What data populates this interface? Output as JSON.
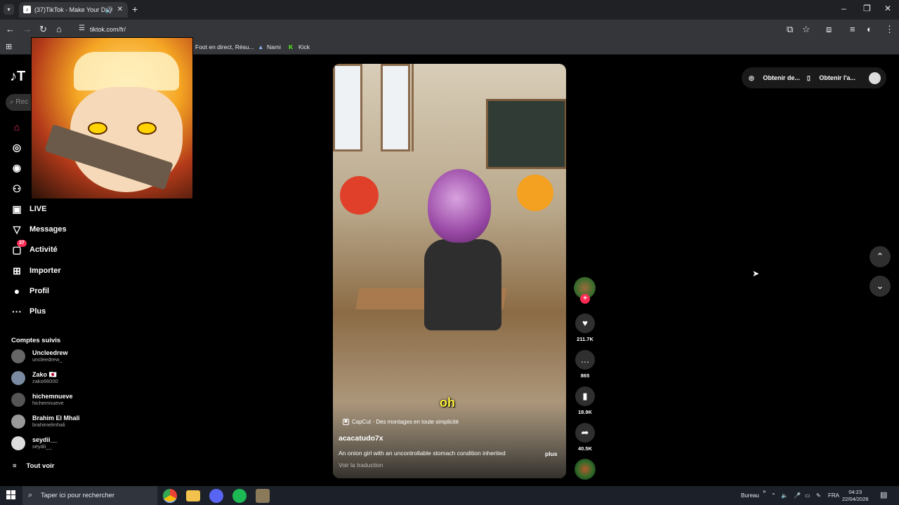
{
  "browser": {
    "tab_title": "(37)TikTok - Make Your Day",
    "tab_favicon": "tiktok-icon",
    "url": "tiktok.com/fr/",
    "bookmarks": [
      {
        "label": "Foot en direct, Résu..."
      },
      {
        "label": "Nami"
      },
      {
        "label": "Kick"
      }
    ]
  },
  "sidebar": {
    "logo": "T",
    "search_placeholder": "Rec",
    "nav": [
      {
        "label": "",
        "icon": "home-icon"
      },
      {
        "label": "",
        "icon": "compass-icon"
      },
      {
        "label": "",
        "icon": "following-icon"
      },
      {
        "label": "",
        "icon": "friends-icon"
      },
      {
        "label": "LIVE",
        "icon": "live-icon"
      },
      {
        "label": "Messages",
        "icon": "messages-icon"
      },
      {
        "label": "Activité",
        "icon": "activity-icon",
        "badge": "37"
      },
      {
        "label": "Importer",
        "icon": "upload-icon"
      },
      {
        "label": "Profil",
        "icon": "profile-icon"
      },
      {
        "label": "Plus",
        "icon": "more-icon"
      }
    ],
    "following_title": "Comptes suivis",
    "following": [
      {
        "name": "Uncleedrew",
        "handle": "uncleedrew_"
      },
      {
        "name": "Zako 🇯🇵",
        "handle": "zako66000"
      },
      {
        "name": "hichemnueve",
        "handle": "hichemnueve"
      },
      {
        "name": "Brahim El Mhali",
        "handle": "brahimelmhali"
      },
      {
        "name": "seydii__",
        "handle": "seydii__"
      }
    ],
    "see_all": "Tout voir"
  },
  "video": {
    "caption_word": "oh",
    "capcut_text": "CapCut · Des montages en toute simplicité",
    "author": "acacatudo7x",
    "description": "An onion girl with an uncontrollable stomach condition inherited",
    "more": "plus",
    "translate": "Voir la traduction"
  },
  "actions": {
    "likes": "211.7K",
    "comments": "865",
    "saves": "18.9K",
    "shares": "40.5K"
  },
  "topbar": {
    "get_coins": "Obtenir de...",
    "get_app": "Obtenir l'a..."
  },
  "taskbar": {
    "search_placeholder": "Taper ici pour rechercher",
    "desktop_label": "Bureau",
    "lang": "FRA",
    "time": "04:23",
    "date": "22/04/2026"
  }
}
